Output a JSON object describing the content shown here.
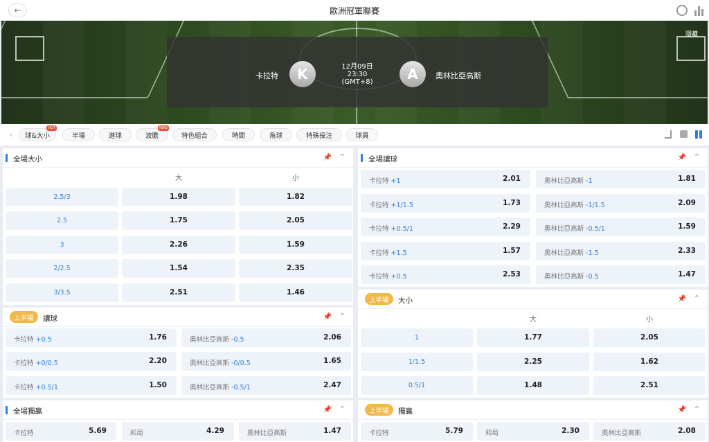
{
  "header": {
    "title": "歐洲冠軍聯賽"
  },
  "banner": {
    "hide_label": "隱藏",
    "home_team": "卡拉特",
    "home_initial": "K",
    "away_team": "奧林比亞高斯",
    "away_initial": "A",
    "date": "12月09日",
    "time": "23:30",
    "tz": "(GMT+8)"
  },
  "tabs": [
    {
      "label": "球&大小",
      "tag": "HOT"
    },
    {
      "label": "半場",
      "tag": ""
    },
    {
      "label": "進球",
      "tag": ""
    },
    {
      "label": "波膽",
      "tag": "NEW"
    },
    {
      "label": "特色組合",
      "tag": ""
    },
    {
      "label": "時間",
      "tag": ""
    },
    {
      "label": "角球",
      "tag": ""
    },
    {
      "label": "特殊投注",
      "tag": ""
    },
    {
      "label": "球員",
      "tag": ""
    }
  ],
  "colors": {
    "accent": "#2f7de1",
    "half_pill": "#f1b84a",
    "hot_tag": "#e8523b"
  },
  "panels": {
    "ft_ou": {
      "title": "全場大小",
      "col_over": "大",
      "col_under": "小",
      "rows": [
        {
          "line": "2.5/3",
          "over": "1.98",
          "under": "1.82"
        },
        {
          "line": "2.5",
          "over": "1.75",
          "under": "2.05"
        },
        {
          "line": "3",
          "over": "2.26",
          "under": "1.59"
        },
        {
          "line": "2/2.5",
          "over": "1.54",
          "under": "2.35"
        },
        {
          "line": "3/3.5",
          "over": "2.51",
          "under": "1.46"
        }
      ]
    },
    "ft_hdp": {
      "title": "全場讓球",
      "rows": [
        {
          "home": "卡拉特",
          "home_line": "+1",
          "home_odd": "2.01",
          "away": "奧林比亞高斯",
          "away_line": "-1",
          "away_odd": "1.81"
        },
        {
          "home": "卡拉特",
          "home_line": "+1/1.5",
          "home_odd": "1.73",
          "away": "奧林比亞高斯",
          "away_line": "-1/1.5",
          "away_odd": "2.09"
        },
        {
          "home": "卡拉特",
          "home_line": "+0.5/1",
          "home_odd": "2.29",
          "away": "奧林比亞高斯",
          "away_line": "-0.5/1",
          "away_odd": "1.59"
        },
        {
          "home": "卡拉特",
          "home_line": "+1.5",
          "home_odd": "1.57",
          "away": "奧林比亞高斯",
          "away_line": "-1.5",
          "away_odd": "2.33"
        },
        {
          "home": "卡拉特",
          "home_line": "+0.5",
          "home_odd": "2.53",
          "away": "奧林比亞高斯",
          "away_line": "-0.5",
          "away_odd": "1.47"
        }
      ]
    },
    "fh_hdp": {
      "pill": "上半場",
      "title": "讓球",
      "rows": [
        {
          "home": "卡拉特",
          "home_line": "+0.5",
          "home_odd": "1.76",
          "away": "奧林比亞高斯",
          "away_line": "-0.5",
          "away_odd": "2.06"
        },
        {
          "home": "卡拉特",
          "home_line": "+0/0.5",
          "home_odd": "2.20",
          "away": "奧林比亞高斯",
          "away_line": "-0/0.5",
          "away_odd": "1.65"
        },
        {
          "home": "卡拉特",
          "home_line": "+0.5/1",
          "home_odd": "1.50",
          "away": "奧林比亞高斯",
          "away_line": "-0.5/1",
          "away_odd": "2.47"
        }
      ]
    },
    "fh_ou": {
      "pill": "上半場",
      "title": "大小",
      "col_over": "大",
      "col_under": "小",
      "rows": [
        {
          "line": "1",
          "over": "1.77",
          "under": "2.05"
        },
        {
          "line": "1/1.5",
          "over": "2.25",
          "under": "1.62"
        },
        {
          "line": "0.5/1",
          "over": "1.48",
          "under": "2.51"
        }
      ]
    },
    "ft_1x2": {
      "title": "全場獨贏",
      "items": [
        {
          "label": "卡拉特",
          "odd": "5.69"
        },
        {
          "label": "和局",
          "odd": "4.29"
        },
        {
          "label": "奧林比亞高斯",
          "odd": "1.47"
        }
      ]
    },
    "fh_1x2": {
      "pill": "上半場",
      "title": "獨贏",
      "items": [
        {
          "label": "卡拉特",
          "odd": "5.79"
        },
        {
          "label": "和局",
          "odd": "2.30"
        },
        {
          "label": "奧林比亞高斯",
          "odd": "2.08"
        }
      ]
    }
  }
}
